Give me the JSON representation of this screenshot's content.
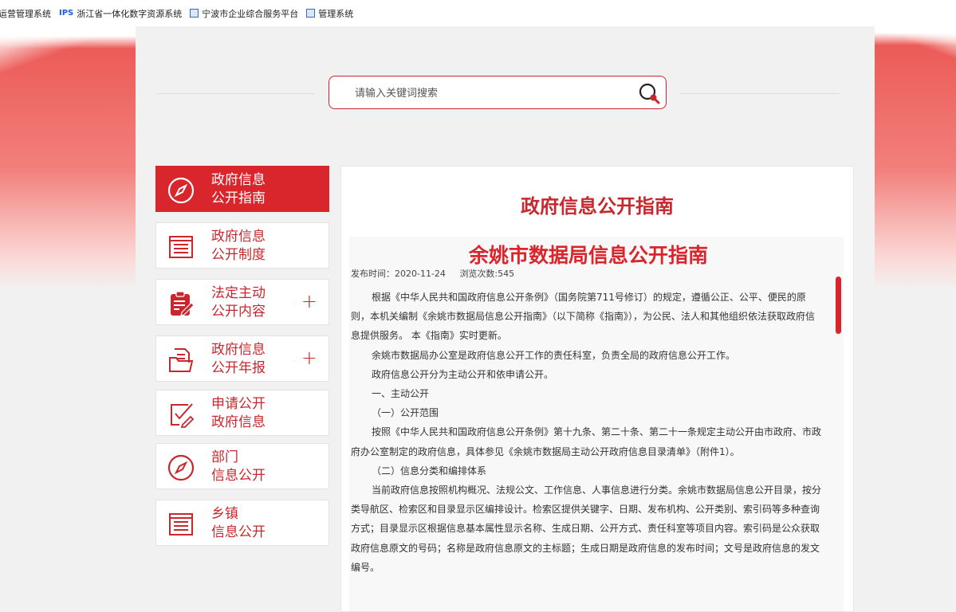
{
  "bookmarks": [
    {
      "label": "运营管理系统",
      "icon": "none"
    },
    {
      "label": "浙江省一体化数字资源系统",
      "icon": "ips-logo",
      "prefix": "IPS"
    },
    {
      "label": "宁波市企业综合服务平台",
      "icon": "building-icon"
    },
    {
      "label": "管理系统",
      "icon": "building-icon"
    }
  ],
  "search": {
    "placeholder": "请输入关键词搜索",
    "value": ""
  },
  "colors": {
    "accent": "#d9262d",
    "text_red": "#c8282d"
  },
  "nav": [
    {
      "line1": "政府信息",
      "line2": "公开指南",
      "icon": "compass-icon",
      "active": true,
      "expandable": false
    },
    {
      "line1": "政府信息",
      "line2": "公开制度",
      "icon": "list-document-icon",
      "active": false,
      "expandable": false
    },
    {
      "line1": "法定主动",
      "line2": "公开内容",
      "icon": "clipboard-edit-icon",
      "active": false,
      "expandable": true,
      "expand_symbol": "+"
    },
    {
      "line1": "政府信息",
      "line2": "公开年报",
      "icon": "folder-document-icon",
      "active": false,
      "expandable": true,
      "expand_symbol": "+"
    },
    {
      "line1": "申请公开",
      "line2": "政府信息",
      "icon": "checkbox-edit-icon",
      "active": false,
      "expandable": false
    },
    {
      "line1": "部门",
      "line2": "信息公开",
      "icon": "compass-icon",
      "active": false,
      "expandable": false
    },
    {
      "line1": "乡镇",
      "line2": "信息公开",
      "icon": "list-document-icon",
      "active": false,
      "expandable": false
    }
  ],
  "main": {
    "title": "政府信息公开指南",
    "doc": {
      "title": "余姚市数据局信息公开指南",
      "publish_label": "发布时间：2020-11-24",
      "views_label": "浏览次数:545",
      "paragraphs": [
        {
          "text": "根据《中华人民共和国政府信息公开条例》（国务院第711号修订）的规定，遵循公正、公平、便民的原则，本机关编制《余姚市数据局信息公开指南》（以下简称《指南》），为公民、法人和其他组织依法获取政府信息提供服务。 本《指南》实时更新。",
          "indent": true
        },
        {
          "text": "余姚市数据局办公室是政府信息公开工作的责任科室，负责全局的政府信息公开工作。",
          "indent": true
        },
        {
          "text": "政府信息公开分为主动公开和依申请公开。",
          "indent": true
        },
        {
          "text": "一、主动公开",
          "indent": true
        },
        {
          "text": "（一）公开范围",
          "indent": true
        },
        {
          "text": "按照《中华人民共和国政府信息公开条例》第十九条、第二十条、第二十一条规定主动公开由市政府、市政府办公室制定的政府信息，具体参见《余姚市数据局主动公开政府信息目录清单》（附件1）。",
          "indent": true
        },
        {
          "text": "（二）信息分类和编排体系",
          "indent": true
        },
        {
          "text": "当前政府信息按照机构概况、法规公文、工作信息、人事信息进行分类。余姚市数据局信息公开目录，按分类导航区、检索区和目录显示区编排设计。检索区提供关键字、日期、发布机构、公开类别、索引码等多种查询方式；目录显示区根据信息基本属性显示名称、生成日期、公开方式、责任科室等项目内容。索引码是公众获取政府信息原文的号码；名称是政府信息原文的主标题；生成日期是政府信息的发布时间；文号是政府信息的发文编号。",
          "indent": true
        }
      ]
    }
  }
}
